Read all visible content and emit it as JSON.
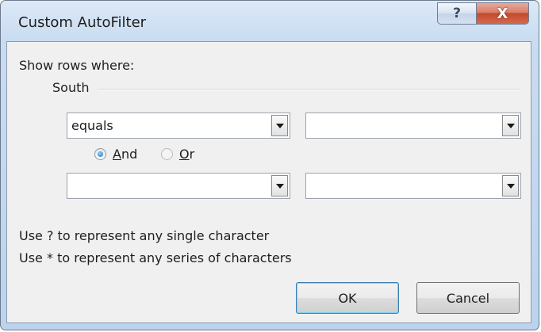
{
  "window": {
    "title": "Custom AutoFilter",
    "help_icon": "question-icon",
    "close_icon": "close-icon",
    "help_glyph": "?",
    "close_glyph": "X"
  },
  "filter": {
    "prompt": "Show rows where:",
    "column": "South",
    "row1": {
      "operator": "equals",
      "value": ""
    },
    "row2": {
      "operator": "",
      "value": ""
    },
    "logic": {
      "and_prefix": "",
      "and_key": "A",
      "and_rest": "nd",
      "or_prefix": "",
      "or_key": "O",
      "or_rest": "r",
      "selected": "And"
    }
  },
  "hints": {
    "single": "Use ? to represent any single character",
    "series": "Use * to represent any series of characters"
  },
  "buttons": {
    "ok": "OK",
    "cancel": "Cancel"
  }
}
